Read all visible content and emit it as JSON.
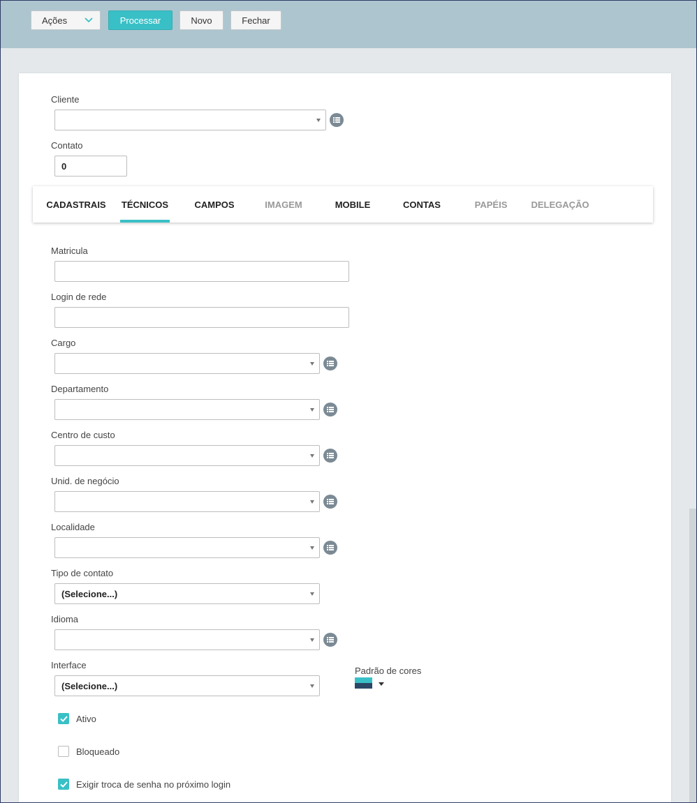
{
  "toolbar": {
    "actions_label": "Ações",
    "process_label": "Processar",
    "new_label": "Novo",
    "close_label": "Fechar"
  },
  "header_form": {
    "cliente_label": "Cliente",
    "cliente_value": "",
    "contato_label": "Contato",
    "contato_value": "0"
  },
  "tabs": [
    {
      "label": "CADASTRAIS",
      "state": "normal"
    },
    {
      "label": "TÉCNICOS",
      "state": "active"
    },
    {
      "label": "CAMPOS",
      "state": "normal"
    },
    {
      "label": "IMAGEM",
      "state": "disabled"
    },
    {
      "label": "MOBILE",
      "state": "normal"
    },
    {
      "label": "CONTAS",
      "state": "normal"
    },
    {
      "label": "PAPÉIS",
      "state": "disabled"
    },
    {
      "label": "DELEGAÇÃO",
      "state": "disabled"
    }
  ],
  "fields": {
    "matricula_label": "Matricula",
    "login_label": "Login de rede",
    "cargo_label": "Cargo",
    "departamento_label": "Departamento",
    "centro_custo_label": "Centro de custo",
    "unid_negocio_label": "Unid. de negócio",
    "localidade_label": "Localidade",
    "tipo_contato_label": "Tipo de contato",
    "tipo_contato_value": "(Selecione...)",
    "idioma_label": "Idioma",
    "interface_label": "Interface",
    "interface_value": "(Selecione...)",
    "padrao_cores_label": "Padrão de cores"
  },
  "checkboxes": {
    "ativo_label": "Ativo",
    "ativo_checked": true,
    "bloqueado_label": "Bloqueado",
    "bloqueado_checked": false,
    "exigir_label": "Exigir troca de senha no próximo login",
    "exigir_checked": true
  },
  "colors": {
    "accent": "#39c0c6",
    "toolbar_bg": "#adc5cf",
    "swatch_top": "#39c0c6",
    "swatch_bottom": "#2a4766",
    "icon_gray": "#7b8a94"
  },
  "icons": {
    "list_icon": "list-icon",
    "chevron": "chevron-down-icon",
    "check": "check-icon"
  }
}
